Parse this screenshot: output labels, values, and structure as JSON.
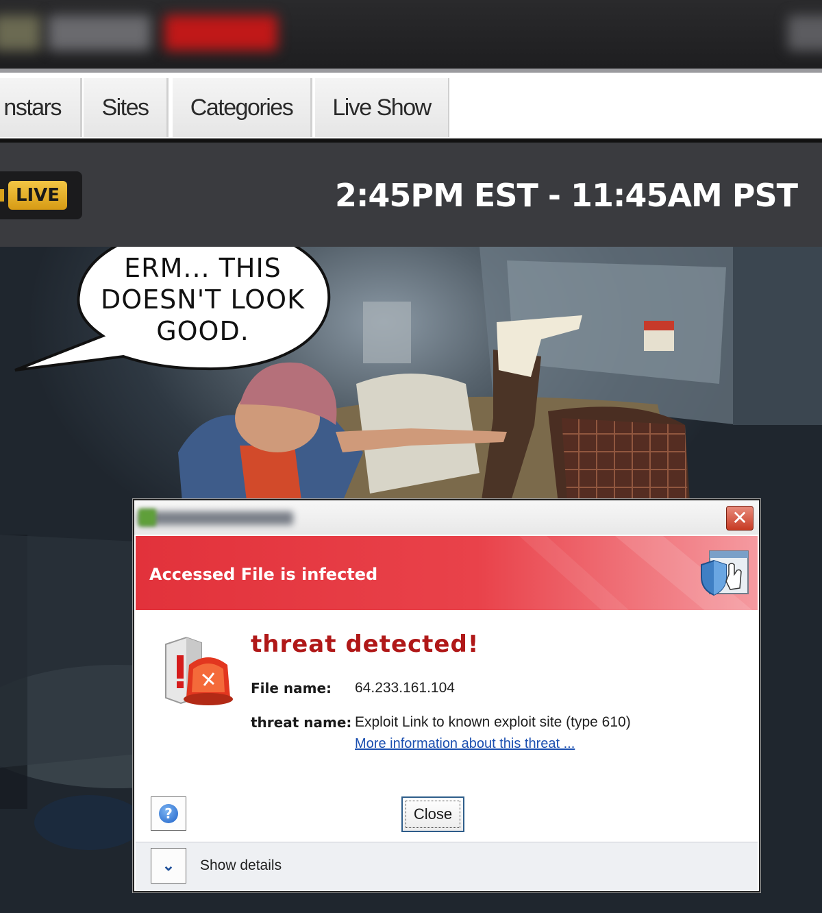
{
  "nav": {
    "tabs": [
      {
        "label": "nstars"
      },
      {
        "label": "Sites"
      },
      {
        "label": "Categories"
      },
      {
        "label": "Live Show"
      }
    ]
  },
  "live_header": {
    "badge": "LIVE",
    "time": "2:45PM EST - 11:45AM PST"
  },
  "comic": {
    "speech": "ERM... THIS DOESN'T LOOK GOOD."
  },
  "dialog": {
    "banner": "Accessed File is infected",
    "heading": "threat detected!",
    "file_label": "File name:",
    "file_value": "64.233.161.104",
    "threat_label": "threat name:",
    "threat_value": "Exploit Link to known exploit site (type 610)",
    "more_link": "More information about this threat ...",
    "help_glyph": "?",
    "close_label": "Close",
    "show_details": "Show details",
    "close_glyph": "✕",
    "expand_glyph": "⌄"
  },
  "colors": {
    "banner_red": "#e2323b",
    "heading_red": "#b01818",
    "live_badge": "#f3c644",
    "link_blue": "#1b4fb0"
  }
}
